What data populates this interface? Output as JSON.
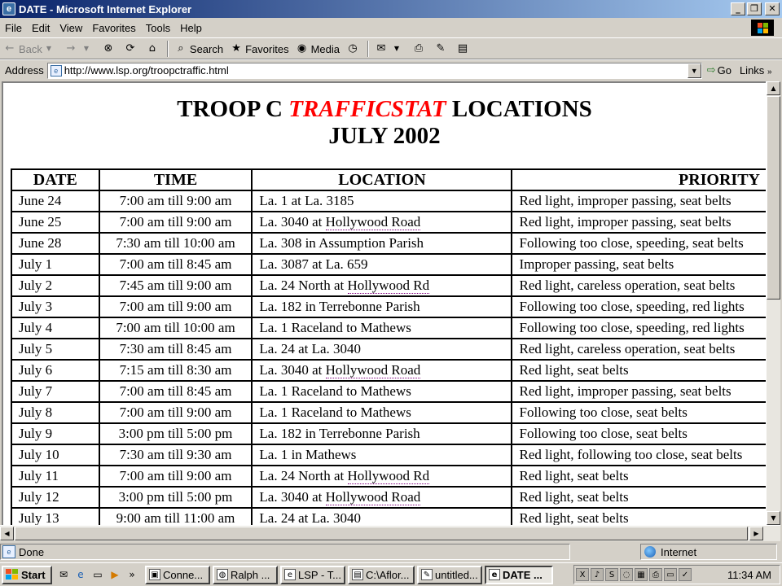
{
  "window": {
    "title": "DATE - Microsoft Internet Explorer"
  },
  "menu": [
    "File",
    "Edit",
    "View",
    "Favorites",
    "Tools",
    "Help"
  ],
  "toolbar": {
    "back": "Back",
    "search": "Search",
    "favorites": "Favorites",
    "media": "Media"
  },
  "address": {
    "label": "Address",
    "url": "http://www.lsp.org/troopctraffic.html",
    "go": "Go",
    "links": "Links"
  },
  "page": {
    "heading_before": "TROOP C ",
    "heading_red": "TRAFFICSTAT",
    "heading_after": " LOCATIONS",
    "subheading": "JULY 2002",
    "columns": [
      "DATE",
      "TIME",
      "LOCATION",
      "PRIORITY"
    ],
    "rows": [
      {
        "date": "June 24",
        "time": "7:00 am till 9:00 am",
        "location": "La. 1 at La. 3185",
        "priority": "Red light, improper passing, seat belts"
      },
      {
        "date": "June 25",
        "time": "7:00 am till 9:00 am",
        "location": "La. 3040 at Hollywood Road",
        "priority": "Red light, improper passing, seat belts"
      },
      {
        "date": "June 28",
        "time": "7:30 am till 10:00 am",
        "location": "La. 308 in Assumption Parish",
        "priority": "Following too close, speeding, seat belts"
      },
      {
        "date": "July 1",
        "time": "7:00 am till 8:45 am",
        "location": "La. 3087 at La. 659",
        "priority": "Improper passing, seat belts"
      },
      {
        "date": "July 2",
        "time": "7:45 am till 9:00 am",
        "location": "La. 24 North at Hollywood Rd",
        "priority": "Red light, careless operation, seat belts"
      },
      {
        "date": "July 3",
        "time": "7:00 am till 9:00 am",
        "location": "La. 182 in Terrebonne Parish",
        "priority": "Following too close, speeding, red lights"
      },
      {
        "date": "July 4",
        "time": "7:00 am till 10:00 am",
        "location": "La. 1 Raceland to Mathews",
        "priority": "Following too close, speeding, red lights"
      },
      {
        "date": "July 5",
        "time": "7:30 am till 8:45 am",
        "location": "La. 24 at La. 3040",
        "priority": "Red light, careless operation, seat belts"
      },
      {
        "date": "July 6",
        "time": "7:15 am till 8:30 am",
        "location": "La. 3040 at Hollywood Road",
        "priority": "Red light, seat belts"
      },
      {
        "date": "July 7",
        "time": "7:00 am till 8:45 am",
        "location": "La. 1 Raceland to Mathews",
        "priority": "Red light, improper passing, seat belts"
      },
      {
        "date": "July 8",
        "time": "7:00 am till 9:00 am",
        "location": "La. 1 Raceland to Mathews",
        "priority": "Following too close, seat belts"
      },
      {
        "date": "July 9",
        "time": "3:00 pm till 5:00 pm",
        "location": "La. 182 in Terrebonne Parish",
        "priority": "Following too close, seat belts"
      },
      {
        "date": "July 10",
        "time": "7:30 am till 9:30 am",
        "location": "La. 1 in Mathews",
        "priority": "Red light, following too close, seat belts"
      },
      {
        "date": "July 11",
        "time": "7:00 am till 9:00 am",
        "location": "La. 24 North at Hollywood Rd",
        "priority": "Red light, seat belts"
      },
      {
        "date": "July 12",
        "time": "3:00 pm till 5:00 pm",
        "location": "La. 3040 at Hollywood Road",
        "priority": "Red light, seat belts"
      },
      {
        "date": "July 13",
        "time": "9:00 am till 11:00 am",
        "location": "La. 24 at La. 3040",
        "priority": "Red light, seat belts"
      }
    ]
  },
  "status": {
    "text": "Done",
    "zone": "Internet"
  },
  "taskbar": {
    "start": "Start",
    "tasks": [
      "Conne...",
      "Ralph ...",
      "LSP - T...",
      "C:\\Aflor...",
      "untitled...",
      "DATE ..."
    ],
    "clock": "11:34 AM"
  },
  "colors": {
    "accent_red": "#ff0000",
    "titlebar": "#0a246a"
  }
}
